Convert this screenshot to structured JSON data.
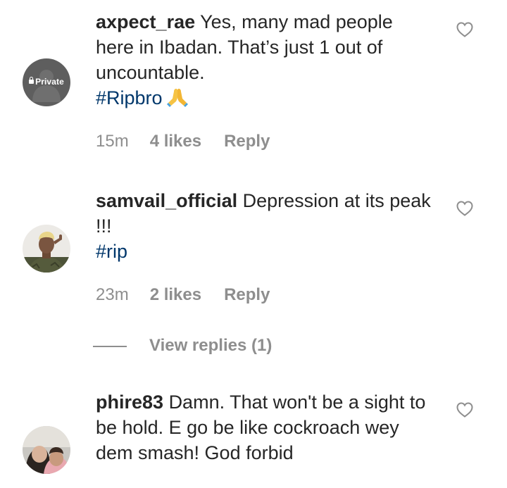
{
  "comments": [
    {
      "username": "axpect_rae",
      "text": "Yes, many mad people here in Ibadan. That’s just 1 out of uncountable.",
      "hashtag": "#Ripbro",
      "emoji": "folded-hands",
      "avatar": "private-avatar",
      "avatar_label": "Private",
      "time": "15m",
      "likes": "4 likes",
      "reply": "Reply"
    },
    {
      "username": "samvail_official",
      "text": "Depression at its peak !!!",
      "hashtag": "#rip",
      "avatar": "user-photo",
      "time": "23m",
      "likes": "2 likes",
      "reply": "Reply"
    },
    {
      "username": "phire83",
      "text": "Damn. That won't be a sight to be hold. E go be like cockroach wey dem smash! God forbid",
      "avatar": "user-photo"
    }
  ],
  "view_replies": "View replies (1)",
  "icons": {
    "like": "heart-outline-icon"
  },
  "colors": {
    "text": "#262626",
    "meta": "#8e8e8e",
    "hashtag": "#00376b"
  }
}
